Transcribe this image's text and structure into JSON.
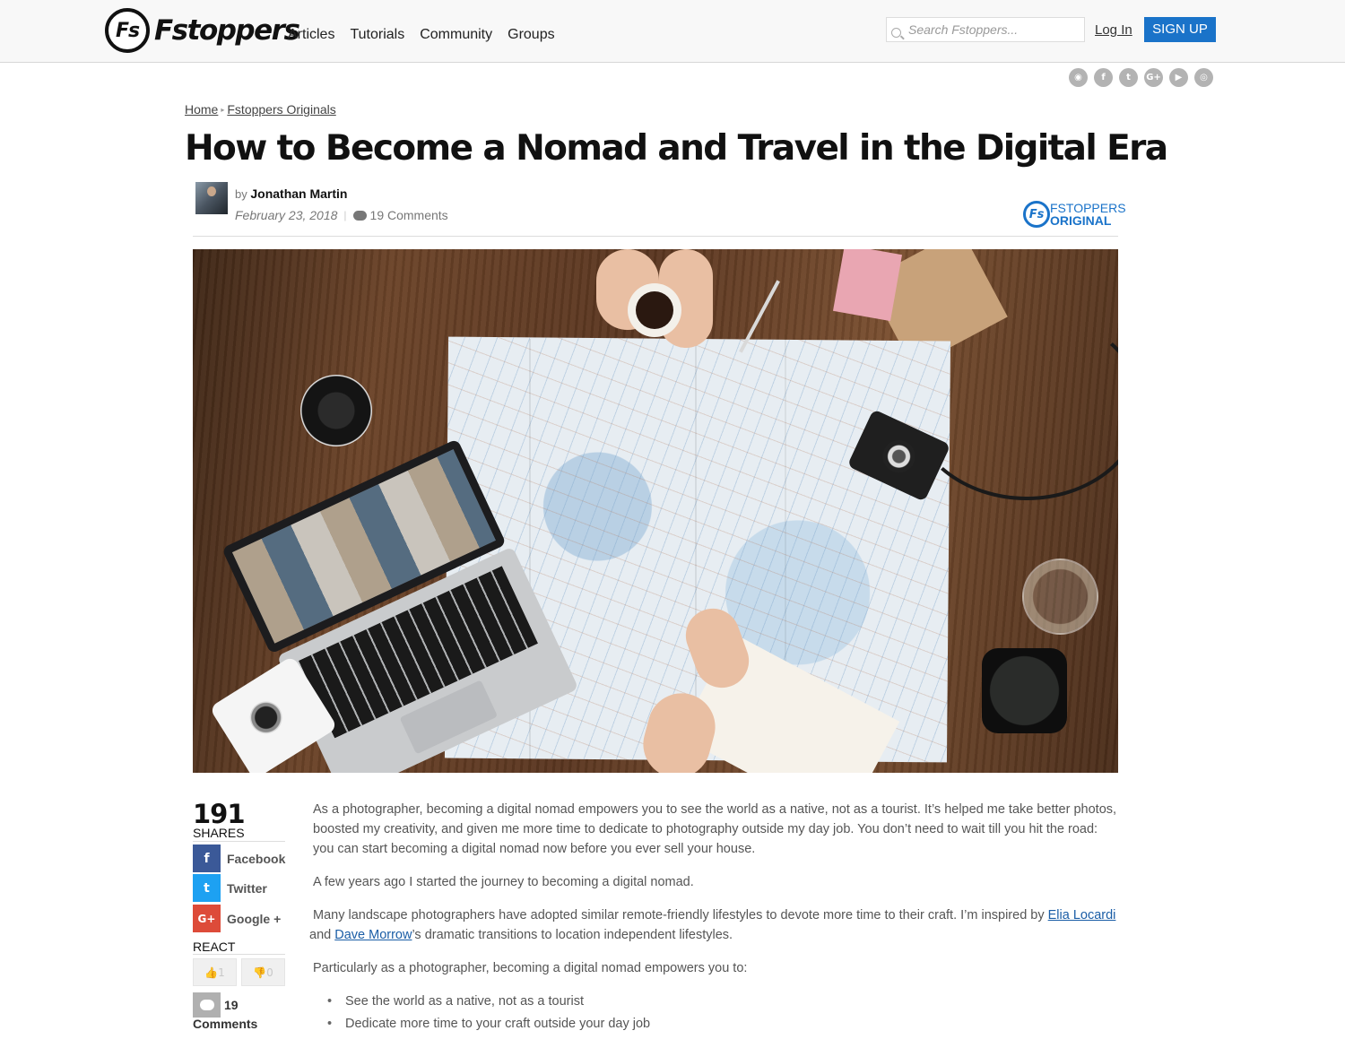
{
  "header": {
    "logo_mark": "Fs",
    "logo_word": "Fstoppers",
    "nav": [
      "Articles",
      "Tutorials",
      "Community",
      "Groups"
    ],
    "search_placeholder": "Search Fstoppers...",
    "login_label": "Log In",
    "signup_label": "SIGN UP"
  },
  "social_icons": [
    "rss-icon",
    "facebook-icon",
    "twitter-icon",
    "google-plus-icon",
    "youtube-icon",
    "instagram-icon"
  ],
  "breadcrumb": {
    "items": [
      "Home",
      "Fstoppers Originals"
    ],
    "separator": "▸"
  },
  "article": {
    "title": "How to Become a Nomad and Travel in the Digital Era",
    "by": "by",
    "author": "Jonathan Martin",
    "date": "February 23, 2018",
    "comments_count_label": "19 Comments",
    "badge_line1": "FSTOPPERS",
    "badge_line2": "ORIGINAL",
    "badge_mark": "Fs"
  },
  "share": {
    "count": "191",
    "label": "SHARES",
    "buttons": [
      {
        "label": "Facebook",
        "icon": "f",
        "color": "#3b5998"
      },
      {
        "label": "Twitter",
        "icon": "t",
        "color": "#1da1f2"
      },
      {
        "label": "Google +",
        "icon": "G+",
        "color": "#dd4b39"
      }
    ],
    "react_label": "REACT",
    "like_count": "1",
    "dislike_count": "0",
    "comment_count": "19",
    "comment_label": "Comments"
  },
  "body": {
    "p1": "As a photographer, becoming a digital nomad empowers you to see the world as a native, not as a tourist. It’s helped me take better photos, boosted my creativity, and given me more time to dedicate to photography outside my day job. You don’t need to wait till you hit the road: you can start becoming a digital nomad now before you ever sell your house.",
    "p2": "A few years ago I started the journey to becoming a digital nomad.",
    "p3_a": "Many landscape photographers have adopted similar remote-friendly lifestyles to devote more time to their craft. I’m inspired by ",
    "link1": "Elia Locardi",
    "p3_b": " and ",
    "link2": "Dave Morrow",
    "p3_c": "’s dramatic transitions to location independent lifestyles.",
    "p4": "Particularly as a photographer, becoming a digital nomad empowers you to:",
    "bullets": [
      "See the world as a native, not as a tourist",
      "Dedicate more time to your craft outside your day job"
    ]
  },
  "colors": {
    "accent": "#1a73c9",
    "link": "#1a5da6",
    "facebook": "#3b5998",
    "twitter": "#1da1f2",
    "google": "#dd4b39"
  }
}
